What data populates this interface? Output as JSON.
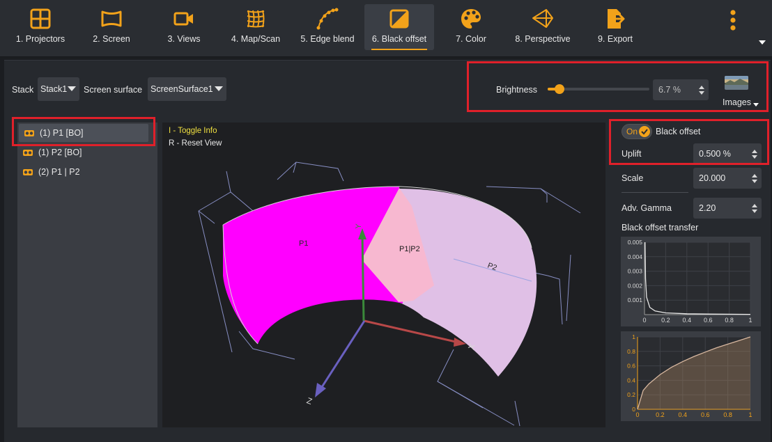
{
  "toolbar": {
    "items": [
      {
        "label": "1. Projectors",
        "icon": "grid-icon"
      },
      {
        "label": "2. Screen",
        "icon": "screen-icon"
      },
      {
        "label": "3. Views",
        "icon": "camera-icon"
      },
      {
        "label": "4. Map/Scan",
        "icon": "mesh-icon"
      },
      {
        "label": "5. Edge blend",
        "icon": "curve-icon"
      },
      {
        "label": "6. Black offset",
        "icon": "black-offset-icon"
      },
      {
        "label": "7. Color",
        "icon": "palette-icon"
      },
      {
        "label": "8. Perspective",
        "icon": "perspective-icon"
      },
      {
        "label": "9. Export",
        "icon": "export-icon"
      }
    ],
    "active_index": 5
  },
  "controls": {
    "stack_label": "Stack",
    "stack_value": "Stack1",
    "screen_surface_label": "Screen surface",
    "screen_surface_value": "ScreenSurface1",
    "brightness_label": "Brightness",
    "brightness_value": "6.7 %",
    "brightness_fraction": 0.067,
    "images_label": "Images"
  },
  "list": {
    "items": [
      {
        "label": "(1) P1 [BO]",
        "selected": true
      },
      {
        "label": "(1) P2 [BO]",
        "selected": false
      },
      {
        "label": "(2) P1 | P2",
        "selected": false
      }
    ]
  },
  "viewport": {
    "hint_info": "I - Toggle Info",
    "hint_reset": "R - Reset View",
    "label_p1": "P1",
    "label_p1p2": "P1|P2",
    "label_p2": "P2",
    "axis_x": "X",
    "axis_y": "Y",
    "axis_z": "Z"
  },
  "black_offset": {
    "toggle_label": "On",
    "title": "Black offset",
    "uplift_label": "Uplift",
    "uplift_value": "0.500 %",
    "scale_label": "Scale",
    "scale_value": "20.000",
    "gamma_label": "Adv. Gamma",
    "gamma_value": "2.20",
    "transfer_label": "Black offset transfer"
  },
  "colors": {
    "accent": "#f2a21a",
    "highlight": "#e0202a",
    "p1": "#ff00ff",
    "overlap": "#f7b8d0",
    "p2": "#e0c0e6"
  },
  "chart_data": [
    {
      "type": "line",
      "x": [
        0.005,
        0.01,
        0.02,
        0.05,
        0.1,
        0.2,
        0.4,
        0.6,
        0.8,
        1.0
      ],
      "values": [
        0.005,
        0.0025,
        0.0012,
        0.0005,
        0.00025,
        0.00012,
        6e-05,
        4e-05,
        3e-05,
        2e-05
      ],
      "xlim": [
        0,
        1
      ],
      "ylim": [
        0,
        0.005
      ],
      "xticks": [
        "0",
        "0.2",
        "0.4",
        "0.6",
        "0.8",
        "1"
      ],
      "yticks": [
        "0.001",
        "0.002",
        "0.003",
        "0.004",
        "0.005"
      ],
      "grid": true
    },
    {
      "type": "area",
      "x": [
        0,
        0.05,
        0.1,
        0.2,
        0.3,
        0.4,
        0.5,
        0.6,
        0.7,
        0.8,
        0.9,
        1.0
      ],
      "values": [
        0,
        0.26,
        0.35,
        0.48,
        0.58,
        0.66,
        0.73,
        0.79,
        0.85,
        0.9,
        0.95,
        1.0
      ],
      "xlim": [
        0,
        1
      ],
      "ylim": [
        0,
        1
      ],
      "xticks": [
        "0",
        "0.2",
        "0.4",
        "0.6",
        "0.8",
        "1"
      ],
      "yticks": [
        "0",
        "0.2",
        "0.4",
        "0.6",
        "0.8",
        "1"
      ],
      "grid": true
    }
  ]
}
